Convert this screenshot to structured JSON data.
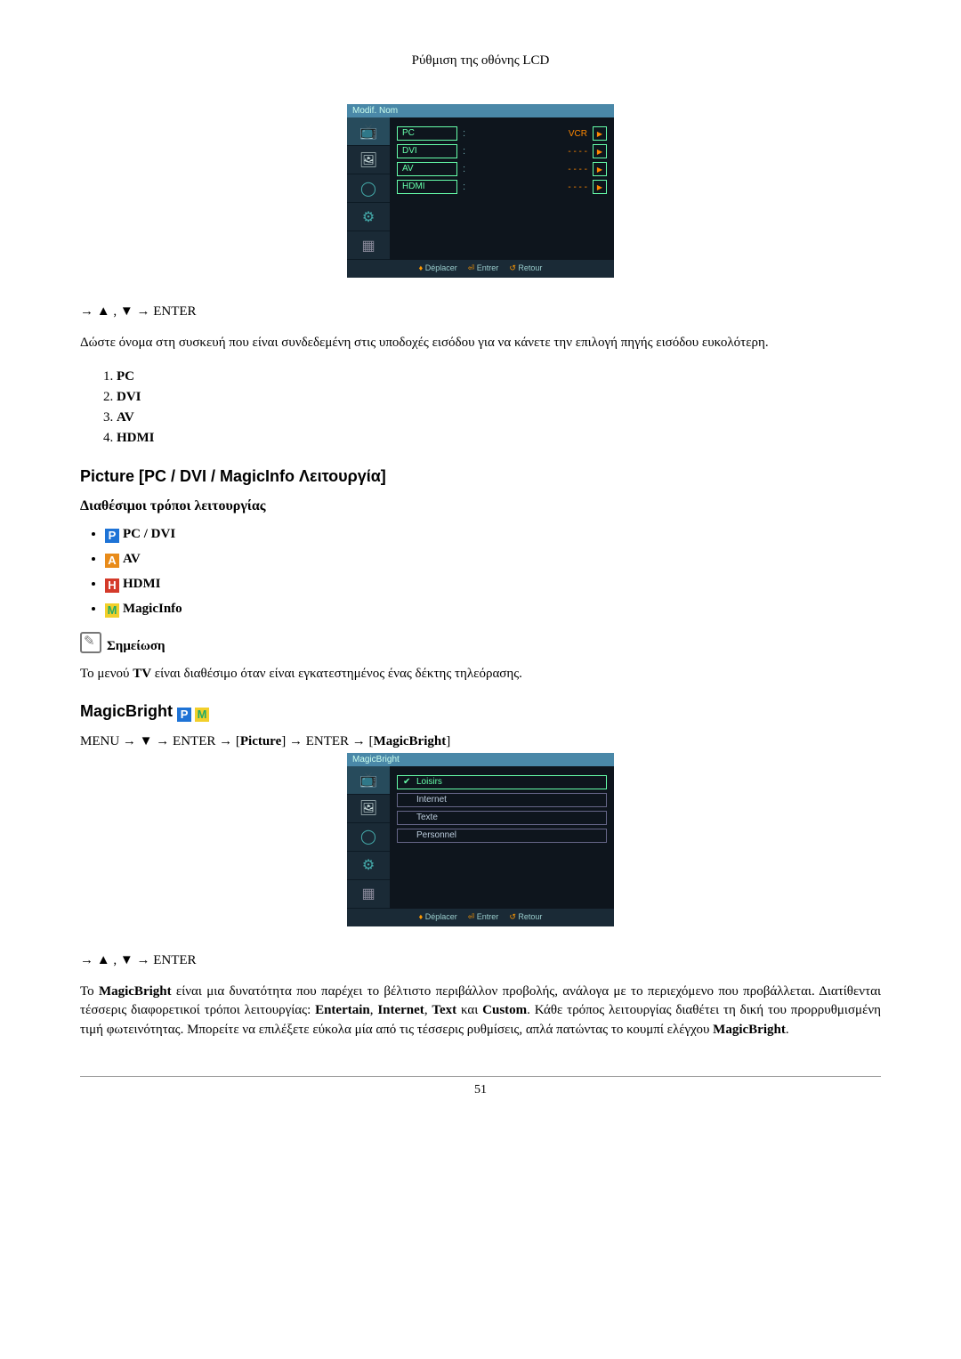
{
  "header": {
    "title": "Ρύθμιση της οθόνης LCD"
  },
  "osd1": {
    "title": "Modif. Nom",
    "rows": [
      {
        "label": "PC",
        "value": "VCR"
      },
      {
        "label": "DVI",
        "value": "- - - -"
      },
      {
        "label": "AV",
        "value": "- - - -"
      },
      {
        "label": "HDMI",
        "value": "- - - -"
      }
    ],
    "footer": {
      "move": "Déplacer",
      "enter": "Entrer",
      "back": "Retour"
    }
  },
  "nav1": {
    "prefix": "→ ",
    "up": "▲",
    "sep": " , ",
    "down": "▼",
    "suffix": " → ENTER"
  },
  "para1": "Δώστε όνομα στη συσκευή που είναι συνδεδεμένη στις υποδοχές εισόδου για να κάνετε την επιλογή πηγής εισόδου ευκολότερη.",
  "list1": [
    {
      "n": "1.",
      "label": "PC"
    },
    {
      "n": "2.",
      "label": "DVI"
    },
    {
      "n": "3.",
      "label": "AV"
    },
    {
      "n": "4.",
      "label": "HDMI"
    }
  ],
  "section_picture": "Picture [PC / DVI / MagicInfo Λειτουργία]",
  "subsection_modes": "Διαθέσιμοι τρόποι λειτουργίας",
  "modes": [
    {
      "badge": "P",
      "label": "PC / DVI"
    },
    {
      "badge": "A",
      "label": "AV"
    },
    {
      "badge": "H",
      "label": "HDMI"
    },
    {
      "badge": "M",
      "label": "MagicInfo"
    }
  ],
  "note": {
    "label": "Σημείωση",
    "text_a": "Το μενού ",
    "text_b": "TV",
    "text_c": " είναι διαθέσιμο όταν είναι εγκατεστημένος ένας δέκτης τηλεόρασης."
  },
  "section_magicbright": "MagicBright",
  "mb_path": {
    "p1": "MENU → ",
    "down": "▼",
    "p2": " → ENTER → [",
    "b1": "Picture",
    "p3": "] → ENTER → [",
    "b2": "MagicBright",
    "p4": "]"
  },
  "osd2": {
    "title": "MagicBright",
    "options": [
      {
        "label": "Loisirs",
        "selected": true
      },
      {
        "label": "Internet",
        "selected": false
      },
      {
        "label": "Texte",
        "selected": false
      },
      {
        "label": "Personnel",
        "selected": false
      }
    ],
    "footer": {
      "move": "Déplacer",
      "enter": "Entrer",
      "back": "Retour"
    }
  },
  "nav2": {
    "prefix": "→ ",
    "up": "▲",
    "sep": " , ",
    "down": "▼",
    "suffix": " → ENTER"
  },
  "para_mb": {
    "t1": "Το ",
    "b1": "MagicBright",
    "t2": " είναι μια δυνατότητα που παρέχει το βέλτιστο περιβάλλον προβολής, ανάλογα με το περιεχόμενο που προβάλλεται. Διατίθενται τέσσερις διαφορετικοί τρόποι λειτουργίας: ",
    "b2": "Entertain",
    "t3": ", ",
    "b3": "Internet",
    "t4": ", ",
    "b4": "Text",
    "t5": " και ",
    "b5": "Custom",
    "t6": ". Κάθε τρόπος λειτουργίας διαθέτει τη δική του προρρυθμισμένη τιμή φωτεινότητας. Μπορείτε να επιλέξετε εύκολα μία από τις τέσσερις ρυθμίσεις, απλά πατώντας το κουμπί ελέγχου ",
    "b6": "MagicBright",
    "t7": "."
  },
  "page_number": "51"
}
